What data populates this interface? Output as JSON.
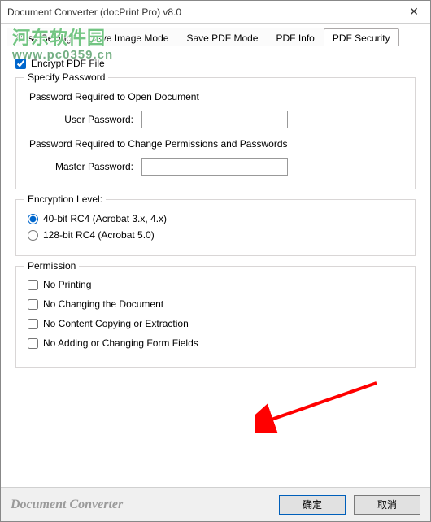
{
  "window": {
    "title": "Document Converter (docPrint Pro) v8.0",
    "close_glyph": "✕"
  },
  "tabs": [
    {
      "label": "Base Setting"
    },
    {
      "label": "Save Image Mode"
    },
    {
      "label": "Save PDF Mode"
    },
    {
      "label": "PDF Info"
    },
    {
      "label": "PDF Security"
    }
  ],
  "encrypt_checkbox_label": "Encrypt PDF File",
  "specify_password": {
    "legend": "Specify Password",
    "open_text": "Password Required to Open Document",
    "user_password_label": "User Password:",
    "user_password_value": "",
    "change_text": "Password Required to Change Permissions and Passwords",
    "master_password_label": "Master Password:",
    "master_password_value": ""
  },
  "encryption_level": {
    "legend": "Encryption Level:",
    "options": [
      {
        "label": "40-bit RC4 (Acrobat 3.x, 4.x)"
      },
      {
        "label": "128-bit RC4 (Acrobat 5.0)"
      }
    ]
  },
  "permission": {
    "legend": "Permission",
    "options": [
      {
        "label": "No Printing"
      },
      {
        "label": "No Changing the Document"
      },
      {
        "label": "No Content Copying or Extraction"
      },
      {
        "label": "No Adding or Changing Form Fields"
      }
    ]
  },
  "footer": {
    "brand": "Document Converter",
    "ok_label": "确定",
    "cancel_label": "取消"
  },
  "watermark": {
    "line1": "河东软件园",
    "line2": "www.pc0359.cn"
  }
}
